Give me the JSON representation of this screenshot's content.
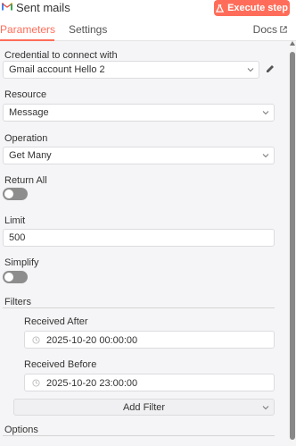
{
  "header": {
    "title": "Sent mails",
    "execute_label": "Execute step",
    "icon": "gmail-icon"
  },
  "tabs": {
    "parameters": "Parameters",
    "settings": "Settings",
    "docs": "Docs"
  },
  "form": {
    "credential": {
      "label": "Credential to connect with",
      "value": "Gmail account Hello 2"
    },
    "resource": {
      "label": "Resource",
      "value": "Message"
    },
    "operation": {
      "label": "Operation",
      "value": "Get Many"
    },
    "return_all": {
      "label": "Return All",
      "enabled": false
    },
    "limit": {
      "label": "Limit",
      "value": "500"
    },
    "simplify": {
      "label": "Simplify",
      "enabled": false
    },
    "filters": {
      "label": "Filters",
      "received_after": {
        "label": "Received After",
        "value": "2025-10-20 00:00:00"
      },
      "received_before": {
        "label": "Received Before",
        "value": "2025-10-20 23:00:00"
      },
      "add_filter_label": "Add Filter"
    },
    "options": {
      "label": "Options"
    }
  },
  "colors": {
    "accent": "#ff6d5a",
    "panel_bg": "#f5f5f7",
    "toggle_off": "#8d8d8d"
  }
}
